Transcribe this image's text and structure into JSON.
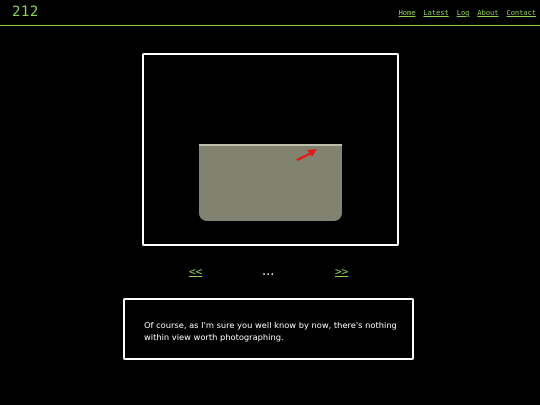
{
  "site": {
    "title": "212"
  },
  "nav": {
    "items": [
      {
        "label": "Home"
      },
      {
        "label": "Latest"
      },
      {
        "label": "Log"
      },
      {
        "label": "About"
      },
      {
        "label": "Contact"
      }
    ]
  },
  "viewer": {
    "prev_label": "<<",
    "next_label": ">>",
    "ellipsis": "..."
  },
  "caption": {
    "text": "Of course, as I'm sure you well know by now, there's nothing within view worth photographing."
  },
  "colors": {
    "accent": "#8fd14f",
    "background": "#000000",
    "frame": "#ffffff",
    "scene": "#828270",
    "pointer": "#e01b1b"
  },
  "icons": {
    "pointer": "red-arrow-icon"
  }
}
